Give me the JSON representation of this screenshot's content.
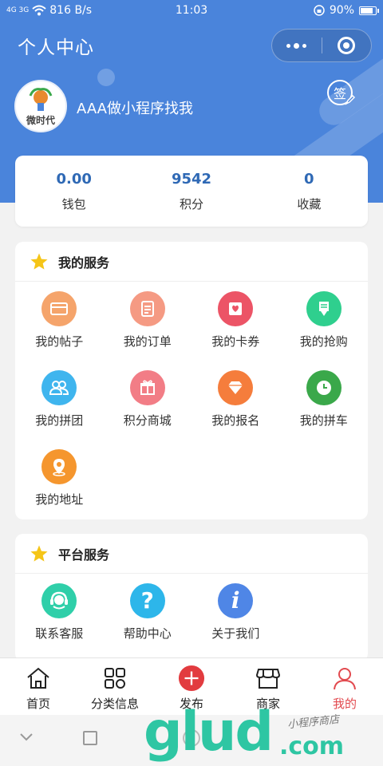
{
  "status_bar": {
    "signal_text": "4G 3G",
    "network_speed": "816 B/s",
    "time": "11:03",
    "battery_percent": "90%",
    "battery_level": 0.9
  },
  "header": {
    "title": "个人中心",
    "username": "AAA做小程序找我",
    "avatar_text": "微时代",
    "sign_label": "签",
    "background_color": "#4a84db"
  },
  "stats": [
    {
      "value": "0.00",
      "label": "钱包"
    },
    {
      "value": "9542",
      "label": "积分"
    },
    {
      "value": "0",
      "label": "收藏"
    }
  ],
  "my_services": {
    "title": "我的服务",
    "items": [
      {
        "label": "我的帖子",
        "icon": "card-icon",
        "color": "#f5a46b"
      },
      {
        "label": "我的订单",
        "icon": "clipboard-icon",
        "color": "#f59a83"
      },
      {
        "label": "我的卡券",
        "icon": "ticket-icon",
        "color": "#ec5466"
      },
      {
        "label": "我的抢购",
        "icon": "flash-sale-icon",
        "color": "#2fcf8e"
      },
      {
        "label": "我的拼团",
        "icon": "group-icon",
        "color": "#3fb5ee"
      },
      {
        "label": "积分商城",
        "icon": "gift-icon",
        "color": "#f27d86"
      },
      {
        "label": "我的报名",
        "icon": "diamond-icon",
        "color": "#f57d3c"
      },
      {
        "label": "我的拼车",
        "icon": "clock-icon",
        "color": "#3aa84a"
      },
      {
        "label": "我的地址",
        "icon": "location-pin-icon",
        "color": "#f5962e"
      }
    ]
  },
  "platform_services": {
    "title": "平台服务",
    "items": [
      {
        "label": "联系客服",
        "icon": "headset-icon",
        "color": "#2fcfa9"
      },
      {
        "label": "帮助中心",
        "icon": "question-icon",
        "color": "#2db6ea"
      },
      {
        "label": "关于我们",
        "icon": "info-icon",
        "color": "#4f86e6"
      }
    ]
  },
  "tabbar": [
    {
      "label": "首页",
      "icon": "home-icon",
      "active": false
    },
    {
      "label": "分类信息",
      "icon": "category-icon",
      "active": false
    },
    {
      "label": "发布",
      "icon": "plus-icon",
      "active": false
    },
    {
      "label": "商家",
      "icon": "store-icon",
      "active": false
    },
    {
      "label": "我的",
      "icon": "person-icon",
      "active": true
    }
  ],
  "watermark": {
    "main": "glud",
    "suffix": ".com",
    "tagline": "小程序商店"
  },
  "colors": {
    "accent": "#4a84db",
    "stat_value": "#2f69b5",
    "active_tab": "#e24a4f",
    "star": "#f5c518"
  }
}
